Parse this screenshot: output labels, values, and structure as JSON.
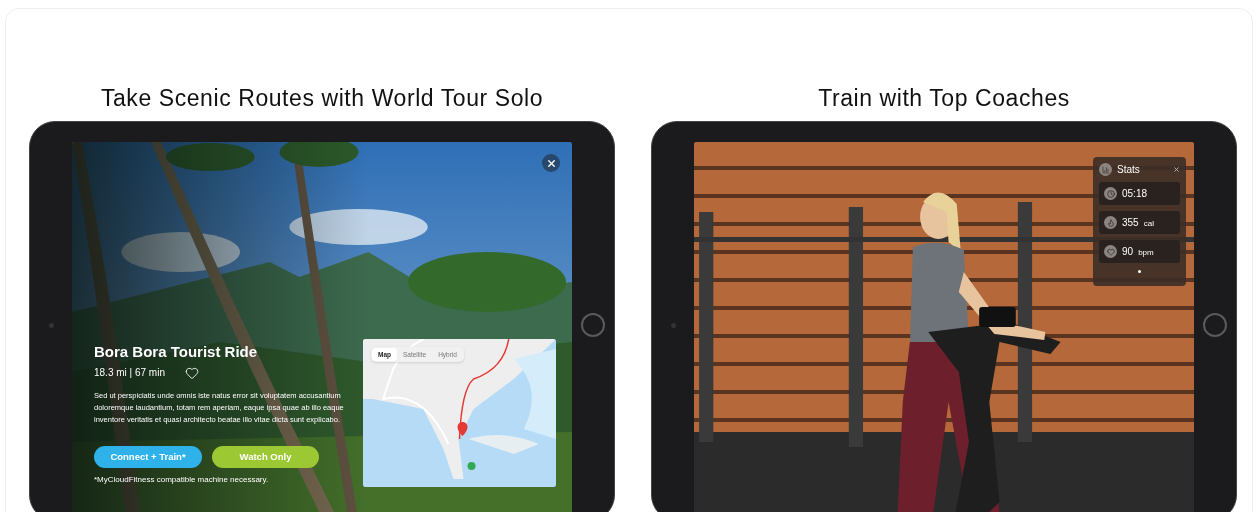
{
  "sections": [
    {
      "heading": "Take Scenic Routes with World Tour Solo",
      "screen": {
        "kind": "route",
        "title": "Bora Bora Tourist Ride",
        "meta": "18.3 mi | 67 min",
        "favorite": false,
        "description": "Sed ut perspiciatis unde omnis iste natus error sit voluptatem accusantium doloremque laudantium, totam rem aperiam, eaque ipsa quae ab illo eaque inventore veritatis et quasi architecto beatae illo vitae dicta sunt explicabo.",
        "buttons": [
          {
            "label": "Connect + Train*",
            "color": "#2fb2ea"
          },
          {
            "label": "Watch Only",
            "color": "#9cc933"
          }
        ],
        "footnote": "*MyCloudFitness compatible machine necessary.",
        "map_tabs": [
          {
            "label": "Map",
            "selected": true
          },
          {
            "label": "Satellite",
            "selected": false
          },
          {
            "label": "Hybrid",
            "selected": false
          }
        ]
      }
    },
    {
      "heading": "Train with Top Coaches",
      "screen": {
        "kind": "coach",
        "panel_title": "Stats",
        "stats": [
          {
            "kind": "time",
            "value": "05:18"
          },
          {
            "kind": "calories",
            "value": "355",
            "unit": "cal"
          },
          {
            "kind": "heart",
            "value": "90",
            "unit": "bpm"
          }
        ]
      }
    }
  ]
}
